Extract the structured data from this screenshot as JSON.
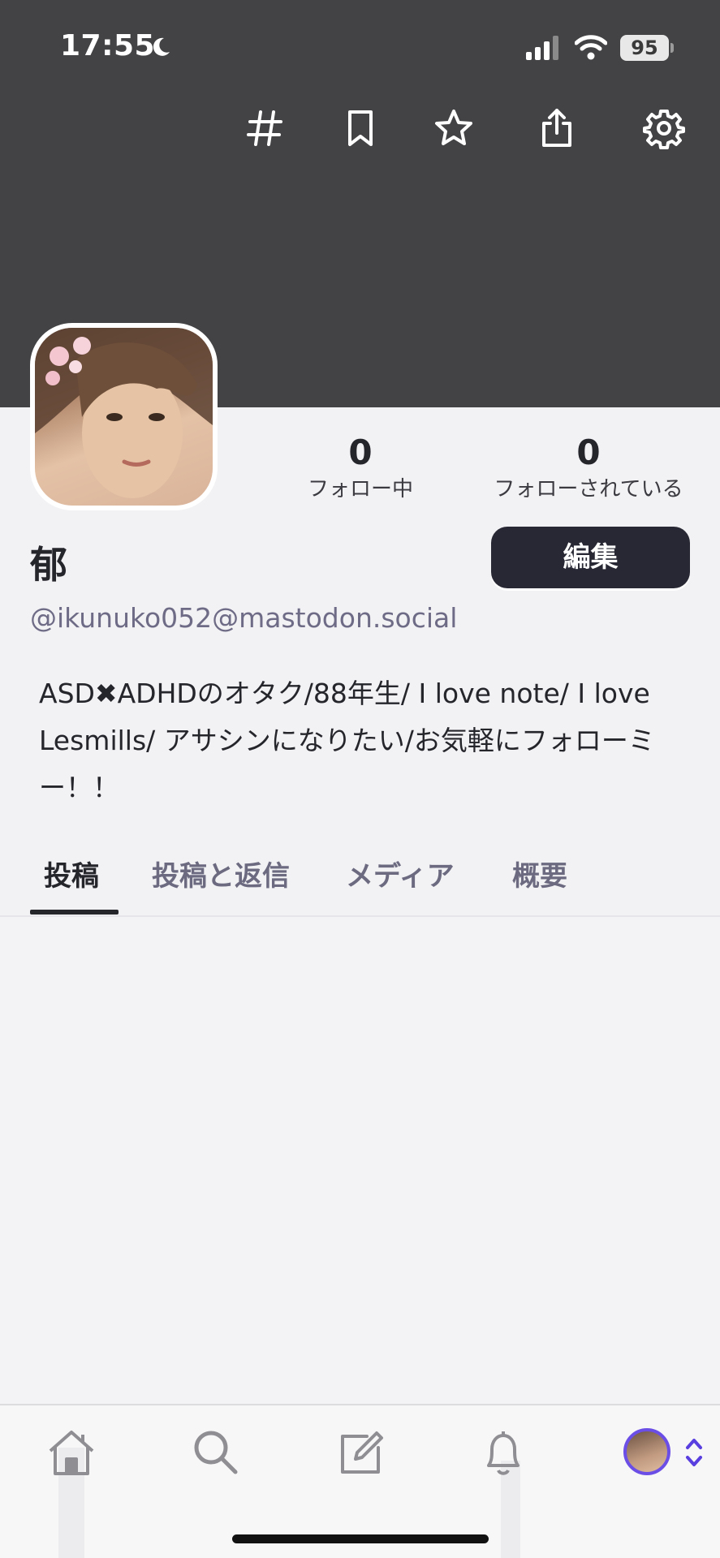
{
  "status_bar": {
    "time": "17:55",
    "battery": "95"
  },
  "header_icons": [
    "hashtag-icon",
    "bookmark-icon",
    "star-icon",
    "share-icon",
    "gear-icon"
  ],
  "profile": {
    "display_name": "郁",
    "handle": "@ikunuko052@mastodon.social",
    "bio": "ASD✖ADHDのオタク/88年生/ I love note/ I love Lesmills/ アサシンになりたい/お気軽にフォローミー！！",
    "edit_label": "編集"
  },
  "stats": {
    "following": {
      "count": "0",
      "label": "フォロー中"
    },
    "followers": {
      "count": "0",
      "label": "フォローされている"
    }
  },
  "tabs": [
    {
      "label": "投稿",
      "active": true
    },
    {
      "label": "投稿と返信",
      "active": false
    },
    {
      "label": "メディア",
      "active": false
    },
    {
      "label": "概要",
      "active": false
    }
  ],
  "bottom_nav": [
    "home-icon",
    "search-icon",
    "compose-icon",
    "bell-icon",
    "account-avatar"
  ],
  "colors": {
    "banner": "#434345",
    "accent": "#6b4ee6",
    "button": "#272833"
  }
}
